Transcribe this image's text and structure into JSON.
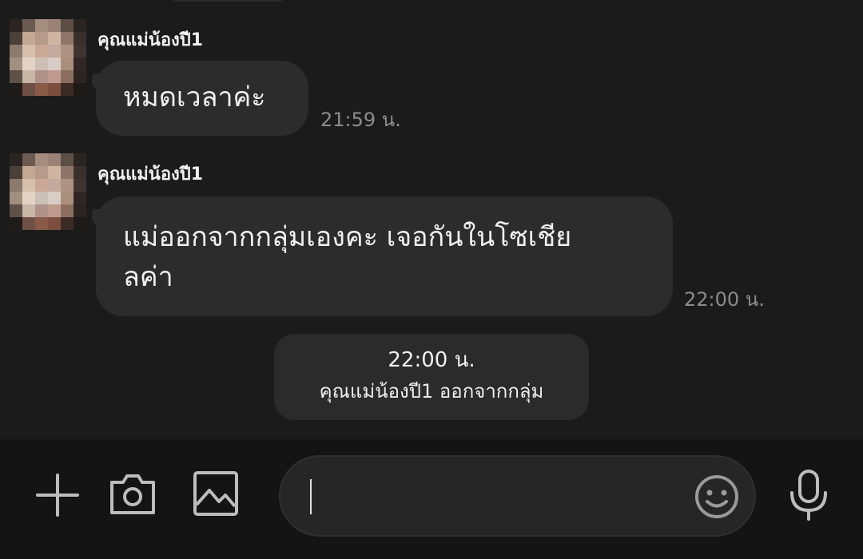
{
  "messages": [
    {
      "sender": "คุณแม่น้องปี1",
      "text": "หมดเวลาค่ะ",
      "time": "21:59 น."
    },
    {
      "sender": "คุณแม่น้องปี1",
      "text_line1": "แม่ออกจากกลุ่มเองคะ เจอกันในโซเชีย",
      "text_line2": "ลค่า",
      "time": "22:00 น."
    }
  ],
  "system_note": {
    "time": "22:00 น.",
    "text": "คุณแม่น้องปี1 ออกจากกลุ่ม"
  },
  "input_bar": {
    "icons": [
      "plus-icon",
      "camera-icon",
      "image-icon",
      "emoji-icon",
      "microphone-icon"
    ],
    "message_value": ""
  },
  "colors": {
    "background": "#1b1b1b",
    "bubble": "#2c2c2c",
    "input_bar": "#141414",
    "text": "#f0f0f0",
    "timestamp": "#8c8c8c",
    "icon": "#bdbdbd"
  }
}
